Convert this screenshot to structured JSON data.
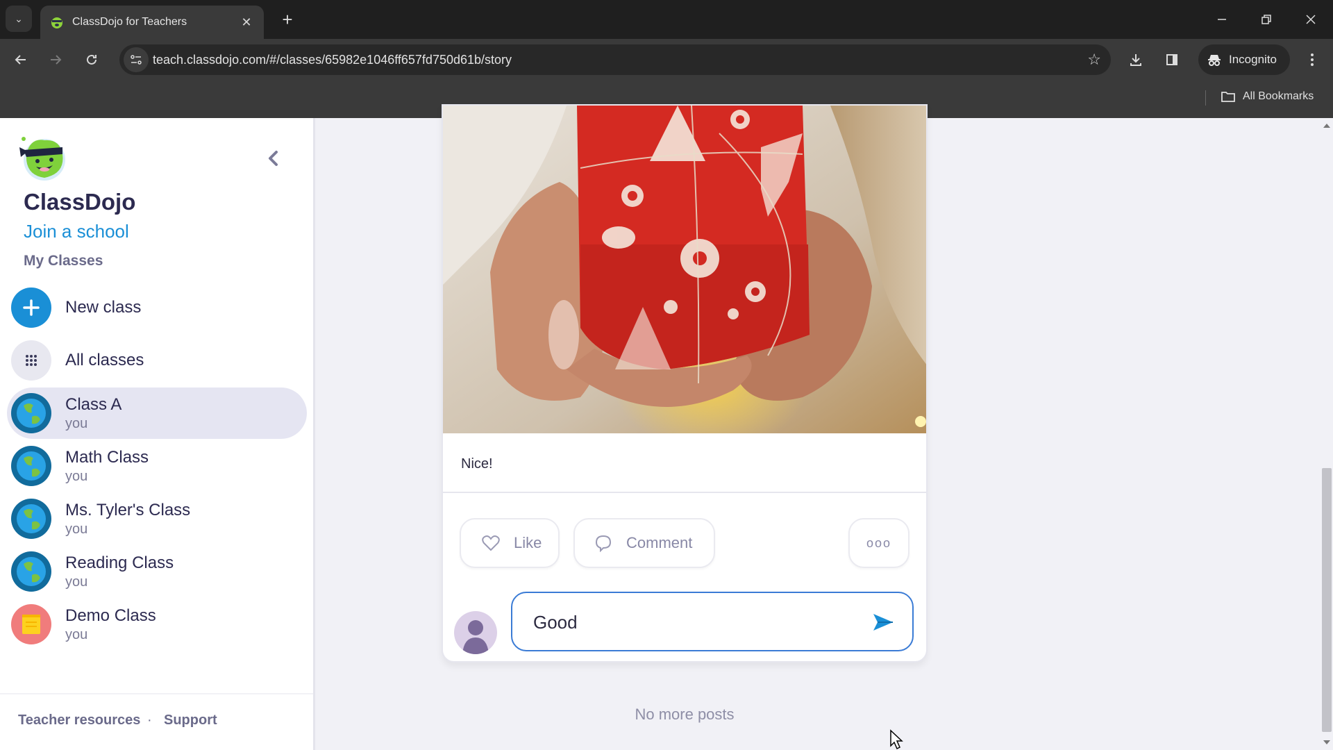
{
  "browser": {
    "tab_title": "ClassDojo for Teachers",
    "url": "teach.classdojo.com/#/classes/65982e1046ff657fd750d61b/story",
    "profile_label": "Incognito",
    "bookmarks_label": "All Bookmarks",
    "new_tab_symbol": "+",
    "close_tab_symbol": "✕"
  },
  "sidebar": {
    "brand": "ClassDojo",
    "join_school": "Join a school",
    "section_title": "My Classes",
    "actions": [
      {
        "label": "New class",
        "icon": "plus-icon",
        "color": "#1a8fd6"
      },
      {
        "label": "All classes",
        "icon": "grid-icon",
        "color": "#e8e8f0"
      }
    ],
    "classes": [
      {
        "name": "Class A",
        "owner": "you",
        "icon": "globe-icon",
        "active": true
      },
      {
        "name": "Math Class",
        "owner": "you",
        "icon": "globe-icon",
        "active": false
      },
      {
        "name": "Ms. Tyler's Class",
        "owner": "you",
        "icon": "globe-icon",
        "active": false
      },
      {
        "name": "Reading Class",
        "owner": "you",
        "icon": "globe-icon",
        "active": false
      },
      {
        "name": "Demo Class",
        "owner": "you",
        "icon": "notebook-icon",
        "active": false
      }
    ],
    "footer": {
      "teacher_resources": "Teacher resources",
      "separator": "·",
      "support": "Support"
    }
  },
  "post": {
    "image_description": "Hands holding a red Christmas-patterned gift box tied with twine",
    "caption": "Nice!",
    "like_label": "Like",
    "comment_label": "Comment",
    "more_symbol": "ooo",
    "comment_input_value": "Good",
    "comment_input_focused": true
  },
  "feed": {
    "end_message": "No more posts"
  },
  "colors": {
    "accent": "#1a8fd6",
    "brand_text": "#2c2a50",
    "muted_text": "#6a6a8a",
    "page_bg": "#f1f1f6",
    "active_item_bg": "#e5e5f2",
    "input_focus_border": "#3a7bd5"
  }
}
